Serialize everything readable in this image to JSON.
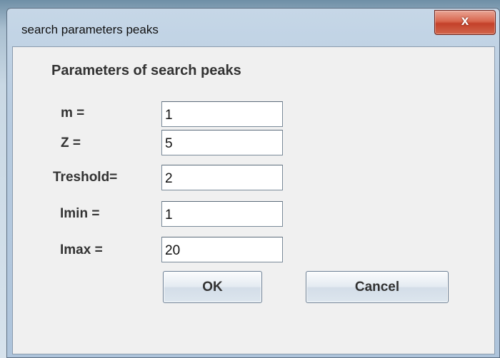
{
  "window": {
    "title": "search parameters peaks",
    "close_glyph": "x",
    "close_icon": "close-icon"
  },
  "dialog": {
    "heading": "Parameters of search peaks",
    "fields": [
      {
        "label": "m =",
        "value": "1"
      },
      {
        "label": "Z =",
        "value": "5"
      },
      {
        "label": "Treshold=",
        "value": "2"
      },
      {
        "label": "Imin =",
        "value": "1"
      },
      {
        "label": "Imax =",
        "value": "20"
      }
    ],
    "buttons": {
      "ok_label": "OK",
      "cancel_label": "Cancel"
    }
  },
  "colors": {
    "client_background": "#f0f0f0",
    "close_button": "#c4412a",
    "title_bar": "#b7cbe0",
    "label_text": "#333333"
  }
}
